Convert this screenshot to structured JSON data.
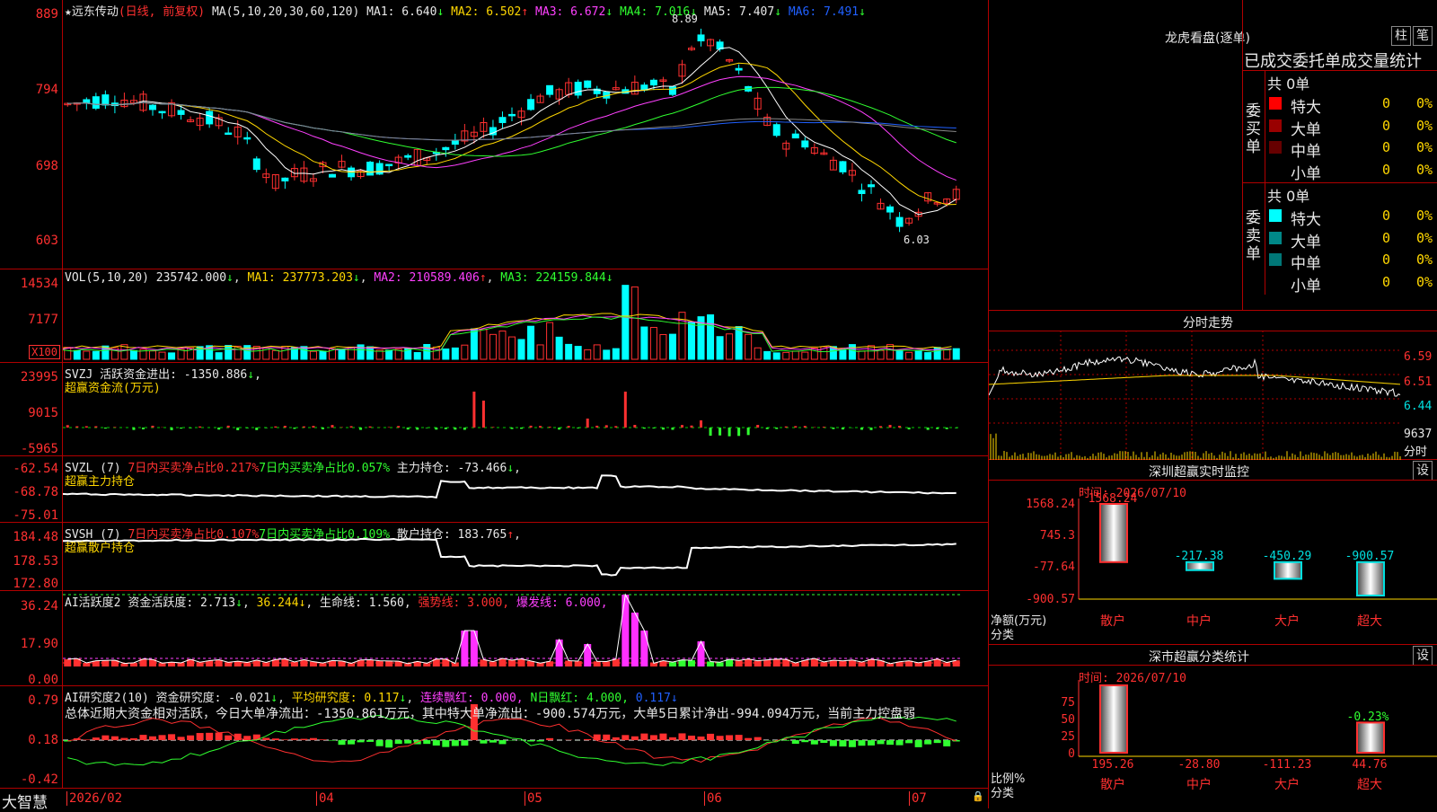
{
  "colors": {
    "up": "#ff3030",
    "down": "#00ffff",
    "ma1": "#ffffff",
    "ma2": "#ffd700",
    "ma3": "#ff40ff",
    "ma4": "#30ff30",
    "ma5": "#2060ff",
    "grid": "#b00000"
  },
  "main": {
    "stock_name": "★远东传动",
    "mode": "(日线, 前复权)",
    "ma_label": "MA(5,10,20,30,60,120)",
    "ma": [
      {
        "label": "MA1: 6.640",
        "arrow": "↓"
      },
      {
        "label": "MA2: 6.502",
        "arrow": "↑"
      },
      {
        "label": "MA3: 6.672",
        "arrow": "↓"
      },
      {
        "label": "MA4: 7.016",
        "arrow": "↓"
      },
      {
        "label": "MA5: 7.407",
        "arrow": "↓"
      },
      {
        "label": "MA6: 7.491",
        "arrow": "↓"
      }
    ],
    "y_ticks": [
      "889",
      "794",
      "698",
      "603"
    ],
    "high_label": "8.89",
    "low_label": "6.03"
  },
  "vol": {
    "title": "VOL(5,10,20)",
    "value": "235742.000",
    "ma1": "MA1: 237773.203",
    "ma2": "MA2: 210589.406",
    "ma3": "MA3: 224159.844",
    "y_ticks": [
      "14534",
      "7177"
    ],
    "unit": "X100"
  },
  "svzj": {
    "title": "SVZJ  活跃资金进出: -1350.886",
    "sub": "超赢资金流(万元)",
    "y_ticks": [
      "23995",
      "9015",
      "-5965"
    ]
  },
  "svzl": {
    "title": "SVZL (7)",
    "a": "7日内买卖净占比0.217%",
    "b": "7日内买卖净占比0.057%",
    "c": "主力持仓: -73.466",
    "sub": "超赢主力持仓",
    "y_ticks": [
      "-62.54",
      "-68.78",
      "-75.01"
    ]
  },
  "svsh": {
    "title": "SVSH (7)",
    "a": "7日内买卖净占比0.107%",
    "b": "7日内买卖净占比0.109%",
    "c": "散户持仓: 183.765",
    "sub": "超赢散户持仓",
    "y_ticks": [
      "184.48",
      "178.53",
      "172.80"
    ]
  },
  "ai1": {
    "title": "AI活跃度2",
    "a": "资金活跃度: 2.713",
    "b": "36.244",
    "c": "生命线: 1.560,",
    "d": "强势线: 3.000,",
    "e": "爆发线: 6.000,",
    "y_ticks": [
      "36.24",
      "17.90",
      "0.00"
    ]
  },
  "ai2": {
    "title": "AI研究度2(10)",
    "a": "资金研究度: -0.021",
    "b": "平均研究度: 0.117",
    "c": "连续飘红: 0.000,",
    "d": "N日飘红: 4.000,",
    "e": "0.117",
    "summary": "总体近期大资金相对活跃，今日大单净流出：-1350.861万元，其中特大单净流出：-900.574万元，大单5日累计净出-994.094万元，当前主力控盘弱",
    "y_ticks": [
      "0.79",
      "0.18",
      "-0.42"
    ]
  },
  "xaxis": {
    "brand": "大智慧",
    "labels": [
      "2026/02",
      "04",
      "05",
      "06",
      "07"
    ]
  },
  "dragon": {
    "title": "龙虎看盘(逐单)",
    "tab1": "柱",
    "tab2": "笔",
    "header": "已成交委托单成交量统计",
    "buy": {
      "side": "委买单",
      "total": "共 0单",
      "rows": [
        {
          "name": "特大",
          "v": "0",
          "p": "0%"
        },
        {
          "name": "大单",
          "v": "0",
          "p": "0%"
        },
        {
          "name": "中单",
          "v": "0",
          "p": "0%"
        },
        {
          "name": "小单",
          "v": "0",
          "p": "0%"
        }
      ]
    },
    "sell": {
      "side": "委卖单",
      "total": "共 0单",
      "rows": [
        {
          "name": "特大",
          "v": "0",
          "p": "0%"
        },
        {
          "name": "大单",
          "v": "0",
          "p": "0%"
        },
        {
          "name": "中单",
          "v": "0",
          "p": "0%"
        },
        {
          "name": "小单",
          "v": "0",
          "p": "0%"
        }
      ]
    }
  },
  "minute": {
    "title": "分时走势",
    "y_ticks": [
      "6.59",
      "6.51",
      "6.44"
    ],
    "vol_tick": "9637",
    "vol_unit": "分时"
  },
  "monitor": {
    "title": "深圳超赢实时监控",
    "setting": "设",
    "time": "时间: 2026/07/10",
    "y_ticks": [
      "1568.24",
      "745.3",
      "-77.64",
      "-900.57"
    ],
    "ylabel": "净额(万元)",
    "xlabel": "分类",
    "bars": [
      {
        "cat": "散户",
        "label": "1568.24",
        "value": 1568.24
      },
      {
        "cat": "中户",
        "label": "-217.38",
        "value": -217.38
      },
      {
        "cat": "大户",
        "label": "-450.29",
        "value": -450.29
      },
      {
        "cat": "超大",
        "label": "-900.57",
        "value": -900.57
      }
    ]
  },
  "classify": {
    "title": "深市超赢分类统计",
    "setting": "设",
    "time": "时间: 2026/07/10",
    "y_ticks": [
      "75",
      "50",
      "25",
      "0"
    ],
    "ylabel": "比例%",
    "xlabel": "分类",
    "top_label": "-0.23%",
    "bars": [
      {
        "cat": "散户",
        "label": "195.26",
        "value": 100
      },
      {
        "cat": "中户",
        "label": "-28.80",
        "value": 0
      },
      {
        "cat": "大户",
        "label": "-111.23",
        "value": 0
      },
      {
        "cat": "超大",
        "label": "44.76",
        "value": 44.76
      }
    ]
  }
}
